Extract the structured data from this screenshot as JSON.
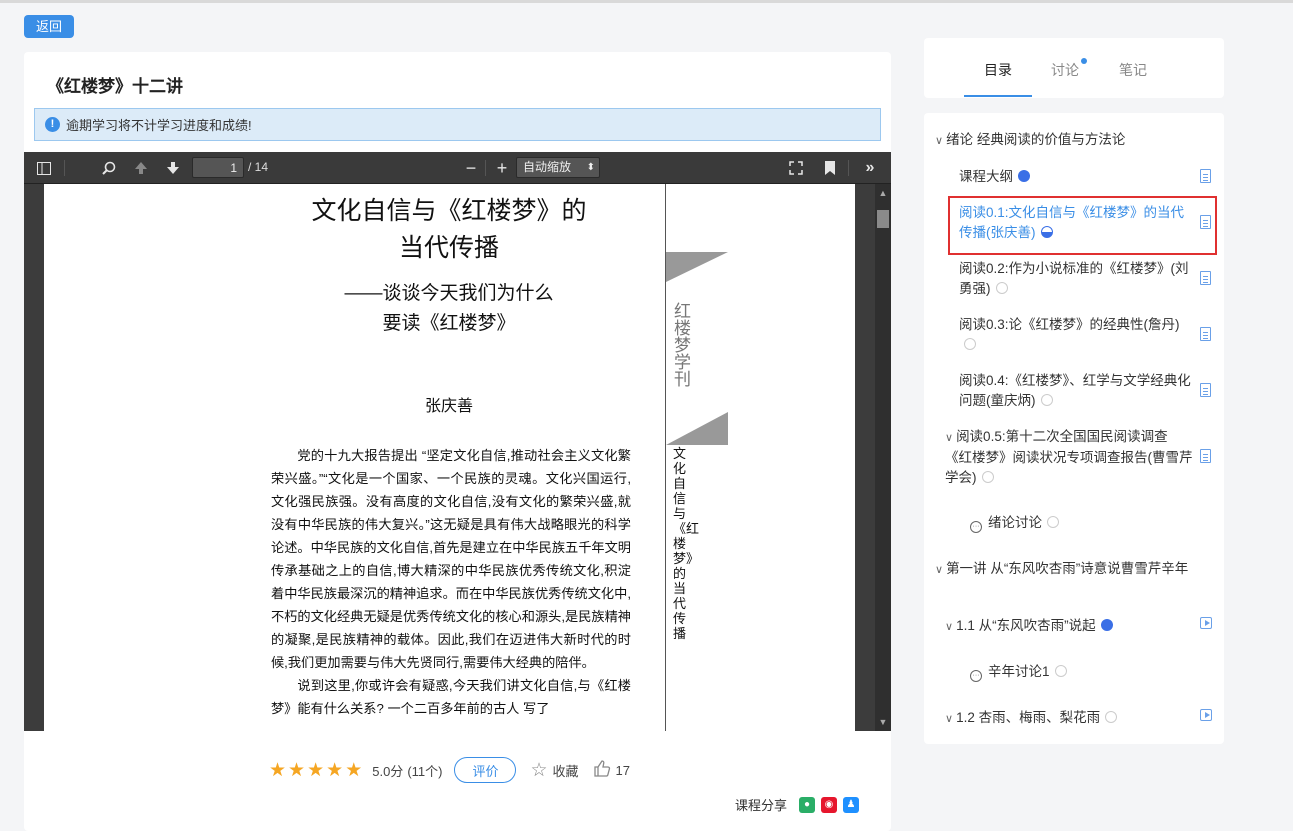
{
  "back_button": "返回",
  "course_title": "《红楼梦》十二讲",
  "notice": {
    "icon": "!",
    "text": "逾期学习将不计学习进度和成绩!"
  },
  "viewer": {
    "page_current": "1",
    "page_total": "/ 14",
    "zoom": "自动缩放"
  },
  "doc": {
    "title_line1": "文化自信与《红楼梦》的",
    "title_line2": "当代传播",
    "subtitle_line1": "——谈谈今天我们为什么",
    "subtitle_line2": "要读《红楼梦》",
    "author": "张庆善",
    "para1": "党的十九大报告提出 “坚定文化自信,推动社会主义文化繁荣兴盛。”“文化是一个国家、一个民族的灵魂。文化兴国运行,文化强民族强。没有高度的文化自信,没有文化的繁荣兴盛,就没有中华民族的伟大复兴。”这无疑是具有伟大战略眼光的科学论述。中华民族的文化自信,首先是建立在中华民族五千年文明传承基础之上的自信,博大精深的中华民族优秀传统文化,积淀着中华民族最深沉的精神追求。而在中华民族优秀传统文化中,不朽的文化经典无疑是优秀传统文化的核心和源头,是民族精神的凝聚,是民族精神的载体。因此,我们在迈进伟大新时代的时候,我们更加需要与伟大先贤同行,需要伟大经典的陪伴。",
    "para2": "说到这里,你或许会有疑惑,今天我们讲文化自信,与《红楼梦》能有什么关系? 一个二百多年前的古人 写了",
    "stamp_text": "红楼梦学刊",
    "vertical_title": "文化自信与《红楼梦》的当代传播"
  },
  "rating": {
    "stars": 5,
    "score": "5.0分",
    "count": "(11个)",
    "rate_button": "评价",
    "favorite": "收藏",
    "likes": "17"
  },
  "share": {
    "label": "课程分享"
  },
  "tabs": [
    {
      "label": "目录"
    },
    {
      "label": "讨论"
    },
    {
      "label": "笔记"
    }
  ],
  "toc": {
    "intro_section": "绪论 经典阅读的价值与方法论",
    "items": [
      {
        "label": "课程大纲"
      },
      {
        "label": "阅读0.1:文化自信与《红楼梦》的当代传播(张庆善)"
      },
      {
        "label": "阅读0.2:作为小说标准的《红楼梦》(刘勇强)"
      },
      {
        "label": "阅读0.3:论《红楼梦》的经典性(詹丹)"
      },
      {
        "label": "阅读0.4:《红楼梦》、红学与文学经典化问题(童庆炳)"
      },
      {
        "label": "阅读0.5:第十二次全国国民阅读调查《红楼梦》阅读状况专项调查报告(曹雪芹学会)"
      },
      {
        "label": "绪论讨论"
      }
    ],
    "chapter1": "第一讲 从“东风吹杏雨”诗意说曹雪芹辛年",
    "ch1_items": [
      {
        "label": "1.1 从“东风吹杏雨”说起"
      },
      {
        "label": "辛年讨论1"
      },
      {
        "label": "1.2 杏雨、梅雨、梨花雨"
      }
    ]
  }
}
